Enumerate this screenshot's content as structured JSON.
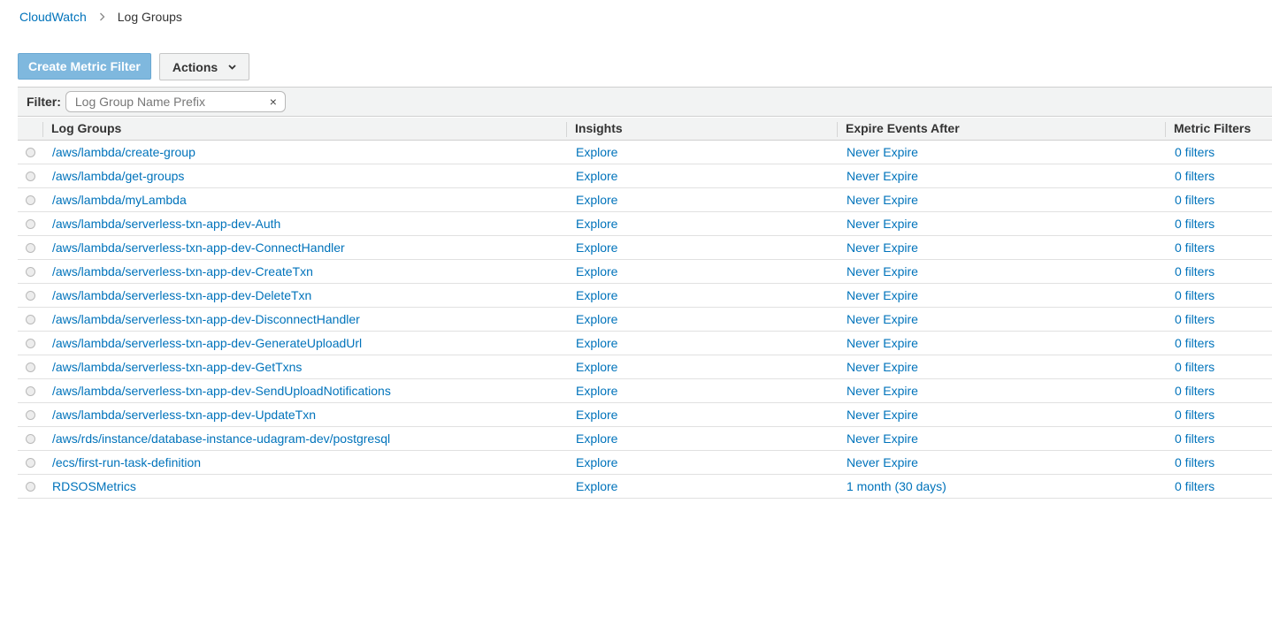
{
  "breadcrumb": {
    "root": "CloudWatch",
    "current": "Log Groups"
  },
  "toolbar": {
    "create_label": "Create Metric Filter",
    "actions_label": "Actions"
  },
  "filter": {
    "label": "Filter:",
    "placeholder": "Log Group Name Prefix",
    "value": "",
    "clear": "×"
  },
  "table": {
    "headers": {
      "log_groups": "Log Groups",
      "insights": "Insights",
      "expire": "Expire Events After",
      "metric_filters": "Metric Filters"
    },
    "rows": [
      {
        "name": "/aws/lambda/create-group",
        "insights": "Explore",
        "expire": "Never Expire",
        "filters": "0 filters"
      },
      {
        "name": "/aws/lambda/get-groups",
        "insights": "Explore",
        "expire": "Never Expire",
        "filters": "0 filters"
      },
      {
        "name": "/aws/lambda/myLambda",
        "insights": "Explore",
        "expire": "Never Expire",
        "filters": "0 filters"
      },
      {
        "name": "/aws/lambda/serverless-txn-app-dev-Auth",
        "insights": "Explore",
        "expire": "Never Expire",
        "filters": "0 filters"
      },
      {
        "name": "/aws/lambda/serverless-txn-app-dev-ConnectHandler",
        "insights": "Explore",
        "expire": "Never Expire",
        "filters": "0 filters"
      },
      {
        "name": "/aws/lambda/serverless-txn-app-dev-CreateTxn",
        "insights": "Explore",
        "expire": "Never Expire",
        "filters": "0 filters"
      },
      {
        "name": "/aws/lambda/serverless-txn-app-dev-DeleteTxn",
        "insights": "Explore",
        "expire": "Never Expire",
        "filters": "0 filters"
      },
      {
        "name": "/aws/lambda/serverless-txn-app-dev-DisconnectHandler",
        "insights": "Explore",
        "expire": "Never Expire",
        "filters": "0 filters"
      },
      {
        "name": "/aws/lambda/serverless-txn-app-dev-GenerateUploadUrl",
        "insights": "Explore",
        "expire": "Never Expire",
        "filters": "0 filters"
      },
      {
        "name": "/aws/lambda/serverless-txn-app-dev-GetTxns",
        "insights": "Explore",
        "expire": "Never Expire",
        "filters": "0 filters"
      },
      {
        "name": "/aws/lambda/serverless-txn-app-dev-SendUploadNotifications",
        "insights": "Explore",
        "expire": "Never Expire",
        "filters": "0 filters"
      },
      {
        "name": "/aws/lambda/serverless-txn-app-dev-UpdateTxn",
        "insights": "Explore",
        "expire": "Never Expire",
        "filters": "0 filters"
      },
      {
        "name": "/aws/rds/instance/database-instance-udagram-dev/postgresql",
        "insights": "Explore",
        "expire": "Never Expire",
        "filters": "0 filters"
      },
      {
        "name": "/ecs/first-run-task-definition",
        "insights": "Explore",
        "expire": "Never Expire",
        "filters": "0 filters"
      },
      {
        "name": "RDSOSMetrics",
        "insights": "Explore",
        "expire": "1 month (30 days)",
        "filters": "0 filters"
      }
    ]
  },
  "colors": {
    "link": "#0073bb",
    "primary_button_disabled": "#7fb8de",
    "header_bg": "#f2f3f3"
  }
}
